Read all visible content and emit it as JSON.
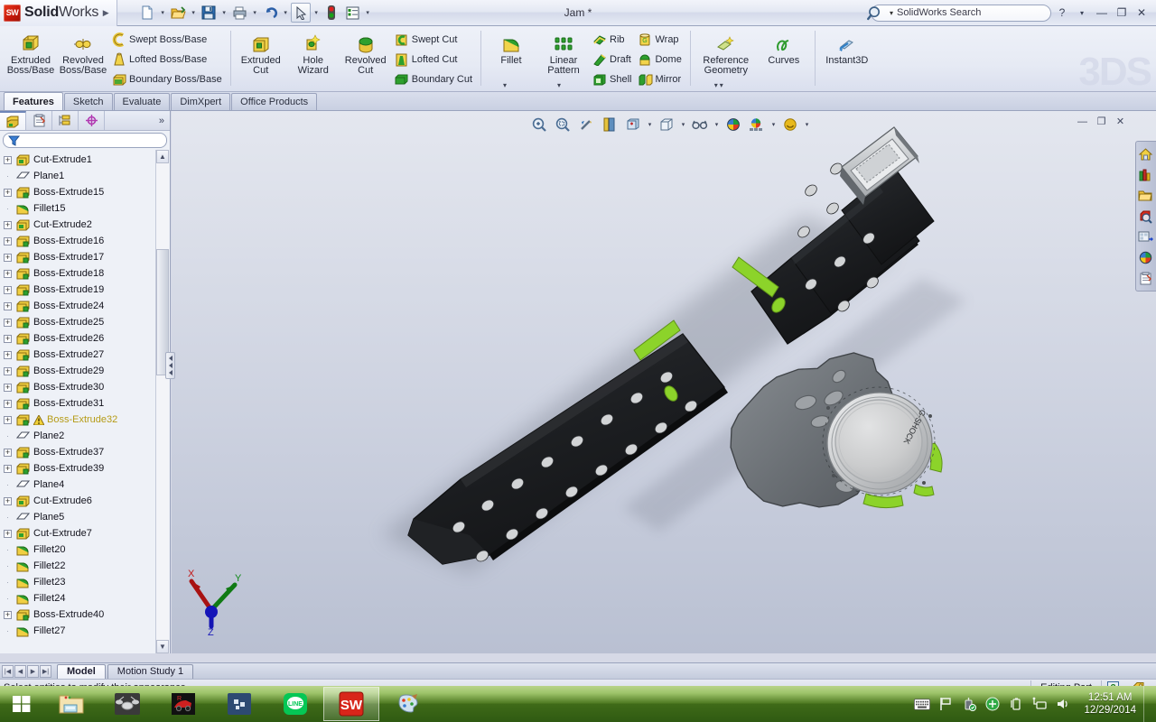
{
  "app": {
    "brand_bold": "Solid",
    "brand_light": "Works",
    "document_title": "Jam *",
    "watermark": "3DS",
    "accent_green": "#8cd32a",
    "accent_red": "#c4170a"
  },
  "quick_access": {
    "items": [
      {
        "name": "new-document",
        "icon": "new-doc-icon",
        "caret": true
      },
      {
        "name": "open-document",
        "icon": "open-folder-icon",
        "caret": true
      },
      {
        "name": "save-document",
        "icon": "save-disk-icon",
        "caret": true
      },
      {
        "name": "print-document",
        "icon": "printer-icon",
        "caret": true
      },
      {
        "name": "undo",
        "icon": "undo-arrow-icon",
        "caret": true
      },
      {
        "name": "select",
        "icon": "cursor-arrow-icon",
        "caret": true
      },
      {
        "name": "rebuild",
        "icon": "traffic-light-icon",
        "caret": false
      },
      {
        "name": "options",
        "icon": "options-list-icon",
        "caret": true
      }
    ]
  },
  "search": {
    "placeholder": "SolidWorks Search",
    "value": "",
    "icon": "magnifier-icon"
  },
  "window_controls": {
    "help": "?",
    "help_caret": "▾",
    "minimize": "—",
    "restore": "❐",
    "close": "✕"
  },
  "ribbon": {
    "groups": [
      {
        "name": "boss-base-group",
        "big": [
          {
            "label_line1": "Extruded",
            "label_line2": "Boss/Base",
            "icon": "extruded-boss-icon"
          },
          {
            "label_line1": "Revolved",
            "label_line2": "Boss/Base",
            "icon": "revolved-boss-icon"
          }
        ],
        "small": [
          {
            "label": "Swept Boss/Base",
            "icon": "swept-boss-icon"
          },
          {
            "label": "Lofted Boss/Base",
            "icon": "lofted-boss-icon"
          },
          {
            "label": "Boundary Boss/Base",
            "icon": "boundary-boss-icon"
          }
        ]
      },
      {
        "name": "cut-group",
        "big": [
          {
            "label_line1": "Extruded",
            "label_line2": "Cut",
            "icon": "extruded-cut-icon"
          },
          {
            "label_line1": "Hole",
            "label_line2": "Wizard",
            "icon": "hole-wizard-icon"
          },
          {
            "label_line1": "Revolved",
            "label_line2": "Cut",
            "icon": "revolved-cut-icon"
          }
        ],
        "small": [
          {
            "label": "Swept Cut",
            "icon": "swept-cut-icon"
          },
          {
            "label": "Lofted Cut",
            "icon": "lofted-cut-icon"
          },
          {
            "label": "Boundary Cut",
            "icon": "boundary-cut-icon"
          }
        ]
      },
      {
        "name": "features-group",
        "big": [
          {
            "label_line1": "Fillet",
            "label_line2": "",
            "icon": "fillet-icon",
            "caret": true
          },
          {
            "label_line1": "Linear",
            "label_line2": "Pattern",
            "icon": "linear-pattern-icon",
            "caret": true
          }
        ],
        "small": [
          {
            "label": "Rib",
            "icon": "rib-icon"
          },
          {
            "label": "Draft",
            "icon": "draft-icon"
          },
          {
            "label": "Shell",
            "icon": "shell-icon"
          }
        ],
        "small2": [
          {
            "label": "Wrap",
            "icon": "wrap-icon"
          },
          {
            "label": "Dome",
            "icon": "dome-icon"
          },
          {
            "label": "Mirror",
            "icon": "mirror-icon"
          }
        ]
      },
      {
        "name": "reference-group",
        "big": [
          {
            "label_line1": "Reference",
            "label_line2": "Geometry",
            "icon": "reference-geometry-icon",
            "caret": true
          },
          {
            "label_line1": "Curves",
            "label_line2": "",
            "icon": "curves-icon",
            "caret": true
          }
        ],
        "small": []
      },
      {
        "name": "instant3d-group",
        "big": [
          {
            "label_line1": "Instant3D",
            "label_line2": "",
            "icon": "instant3d-icon"
          }
        ],
        "small": []
      }
    ]
  },
  "command_tabs": [
    {
      "label": "Features",
      "active": true
    },
    {
      "label": "Sketch",
      "active": false
    },
    {
      "label": "Evaluate",
      "active": false
    },
    {
      "label": "DimXpert",
      "active": false
    },
    {
      "label": "Office Products",
      "active": false
    }
  ],
  "panel": {
    "tabs": [
      {
        "name": "feature-manager-tab",
        "icon": "feature-tree-icon",
        "active": true
      },
      {
        "name": "property-manager-tab",
        "icon": "property-clipboard-icon",
        "active": false
      },
      {
        "name": "configuration-manager-tab",
        "icon": "configuration-icon",
        "active": false
      },
      {
        "name": "dimxpert-manager-tab",
        "icon": "dimxpert-target-icon",
        "active": false
      }
    ],
    "more_label": "»",
    "filter": {
      "placeholder": "",
      "value": "",
      "icon": "filter-funnel-icon"
    }
  },
  "feature_tree": [
    {
      "label": "Cut-Extrude1",
      "icon": "cut-extrude-icon",
      "expandable": true,
      "warning": false
    },
    {
      "label": "Plane1",
      "icon": "plane-icon",
      "expandable": false,
      "warning": false
    },
    {
      "label": "Boss-Extrude15",
      "icon": "boss-extrude-icon",
      "expandable": true,
      "warning": false
    },
    {
      "label": "Fillet15",
      "icon": "fillet-feature-icon",
      "expandable": false,
      "warning": false
    },
    {
      "label": "Cut-Extrude2",
      "icon": "cut-extrude-icon",
      "expandable": true,
      "warning": false
    },
    {
      "label": "Boss-Extrude16",
      "icon": "boss-extrude-icon",
      "expandable": true,
      "warning": false
    },
    {
      "label": "Boss-Extrude17",
      "icon": "boss-extrude-icon",
      "expandable": true,
      "warning": false
    },
    {
      "label": "Boss-Extrude18",
      "icon": "boss-extrude-icon",
      "expandable": true,
      "warning": false
    },
    {
      "label": "Boss-Extrude19",
      "icon": "boss-extrude-icon",
      "expandable": true,
      "warning": false
    },
    {
      "label": "Boss-Extrude24",
      "icon": "boss-extrude-icon",
      "expandable": true,
      "warning": false
    },
    {
      "label": "Boss-Extrude25",
      "icon": "boss-extrude-icon",
      "expandable": true,
      "warning": false
    },
    {
      "label": "Boss-Extrude26",
      "icon": "boss-extrude-icon",
      "expandable": true,
      "warning": false
    },
    {
      "label": "Boss-Extrude27",
      "icon": "boss-extrude-icon",
      "expandable": true,
      "warning": false
    },
    {
      "label": "Boss-Extrude29",
      "icon": "boss-extrude-icon",
      "expandable": true,
      "warning": false
    },
    {
      "label": "Boss-Extrude30",
      "icon": "boss-extrude-icon",
      "expandable": true,
      "warning": false
    },
    {
      "label": "Boss-Extrude31",
      "icon": "boss-extrude-icon",
      "expandable": true,
      "warning": false
    },
    {
      "label": "Boss-Extrude32",
      "icon": "boss-extrude-icon",
      "expandable": true,
      "warning": true
    },
    {
      "label": "Plane2",
      "icon": "plane-icon",
      "expandable": false,
      "warning": false
    },
    {
      "label": "Boss-Extrude37",
      "icon": "boss-extrude-icon",
      "expandable": true,
      "warning": false
    },
    {
      "label": "Boss-Extrude39",
      "icon": "boss-extrude-icon",
      "expandable": true,
      "warning": false
    },
    {
      "label": "Plane4",
      "icon": "plane-icon",
      "expandable": false,
      "warning": false
    },
    {
      "label": "Cut-Extrude6",
      "icon": "cut-extrude-icon",
      "expandable": true,
      "warning": false
    },
    {
      "label": "Plane5",
      "icon": "plane-icon",
      "expandable": false,
      "warning": false
    },
    {
      "label": "Cut-Extrude7",
      "icon": "cut-extrude-icon",
      "expandable": true,
      "warning": false
    },
    {
      "label": "Fillet20",
      "icon": "fillet-feature-icon",
      "expandable": false,
      "warning": false
    },
    {
      "label": "Fillet22",
      "icon": "fillet-feature-icon",
      "expandable": false,
      "warning": false
    },
    {
      "label": "Fillet23",
      "icon": "fillet-feature-icon",
      "expandable": false,
      "warning": false
    },
    {
      "label": "Fillet24",
      "icon": "fillet-feature-icon",
      "expandable": false,
      "warning": false
    },
    {
      "label": "Boss-Extrude40",
      "icon": "boss-extrude-icon",
      "expandable": true,
      "warning": false
    },
    {
      "label": "Fillet27",
      "icon": "fillet-feature-icon",
      "expandable": false,
      "warning": false
    }
  ],
  "viewport_toolbar": [
    {
      "name": "zoom-to-fit-button",
      "icon": "zoom-fit-icon",
      "caret": false
    },
    {
      "name": "zoom-to-area-button",
      "icon": "zoom-area-icon",
      "caret": false
    },
    {
      "name": "previous-view-button",
      "icon": "previous-view-icon",
      "caret": false
    },
    {
      "name": "section-view-button",
      "icon": "section-view-icon",
      "caret": false
    },
    {
      "name": "view-orientation-button",
      "icon": "view-orientation-icon",
      "caret": true
    },
    {
      "name": "display-style-button",
      "icon": "display-style-cube-icon",
      "caret": true
    },
    {
      "name": "hide-show-items-button",
      "icon": "glasses-icon",
      "caret": true
    },
    {
      "name": "edit-appearance-button",
      "icon": "appearance-sphere-icon",
      "caret": false
    },
    {
      "name": "apply-scene-button",
      "icon": "scene-icon",
      "caret": true
    },
    {
      "name": "view-settings-button",
      "icon": "view-settings-icon",
      "caret": true
    }
  ],
  "task_pane": [
    {
      "name": "solidworks-resources-button",
      "icon": "home-house-icon"
    },
    {
      "name": "design-library-button",
      "icon": "design-library-icon"
    },
    {
      "name": "file-explorer-button",
      "icon": "folder-icon"
    },
    {
      "name": "search-button",
      "icon": "search-cube-icon"
    },
    {
      "name": "view-palette-button",
      "icon": "view-palette-icon"
    },
    {
      "name": "appearances-scenes-button",
      "icon": "appearance-sphere-icon"
    },
    {
      "name": "custom-properties-button",
      "icon": "custom-properties-icon"
    }
  ],
  "axes_triad": {
    "x_label": "X",
    "y_label": "Y",
    "z_label": "Z",
    "x_color": "#b01414",
    "y_color": "#0f8a15",
    "z_color": "#1a1ab0"
  },
  "model": {
    "name": "wrist-watch-model",
    "body_color": "#6e7276",
    "strap_color": "#1d1f22",
    "accent_color": "#8cd32a",
    "face_color": "#c9cacb",
    "brand_text": "G-SHOCK"
  },
  "bottom_tabs": {
    "nav": [
      {
        "name": "first-tab-button",
        "glyph": "|◀"
      },
      {
        "name": "previous-tab-button",
        "glyph": "◀"
      },
      {
        "name": "next-tab-button",
        "glyph": "▶"
      },
      {
        "name": "last-tab-button",
        "glyph": "▶|"
      }
    ],
    "tabs": [
      {
        "label": "Model",
        "active": true
      },
      {
        "label": "Motion Study 1",
        "active": false
      }
    ]
  },
  "status_bar": {
    "message": "Select entities to modify their appearance",
    "edit_state": "Editing Part",
    "help_glyph": "?",
    "tag_icon": "tag-icon"
  },
  "taskbar": {
    "start": {
      "name": "start-button",
      "icon": "windows-logo-icon"
    },
    "items": [
      {
        "name": "file-explorer-taskbar-item",
        "icon": "folder-explorer-icon",
        "active": false
      },
      {
        "name": "drums-app-taskbar-item",
        "icon": "drum-kit-icon",
        "active": false
      },
      {
        "name": "media-app-taskbar-item",
        "icon": "red-car-icon",
        "active": false
      },
      {
        "name": "blue-app-taskbar-item",
        "icon": "blue-squares-icon",
        "active": false
      },
      {
        "name": "line-taskbar-item",
        "icon": "line-messenger-icon",
        "active": false
      },
      {
        "name": "solidworks-taskbar-item",
        "icon": "solidworks-cube-icon",
        "active": true
      },
      {
        "name": "paint-taskbar-item",
        "icon": "paint-palette-icon",
        "active": false
      }
    ],
    "tray": [
      {
        "name": "touch-keyboard-icon"
      },
      {
        "name": "flag-action-center-icon"
      },
      {
        "name": "usb-safely-remove-icon"
      },
      {
        "name": "green-shield-icon"
      },
      {
        "name": "battery-icon"
      },
      {
        "name": "network-icon"
      },
      {
        "name": "volume-icon"
      }
    ],
    "clock": {
      "time": "12:51 AM",
      "date": "12/29/2014"
    }
  }
}
